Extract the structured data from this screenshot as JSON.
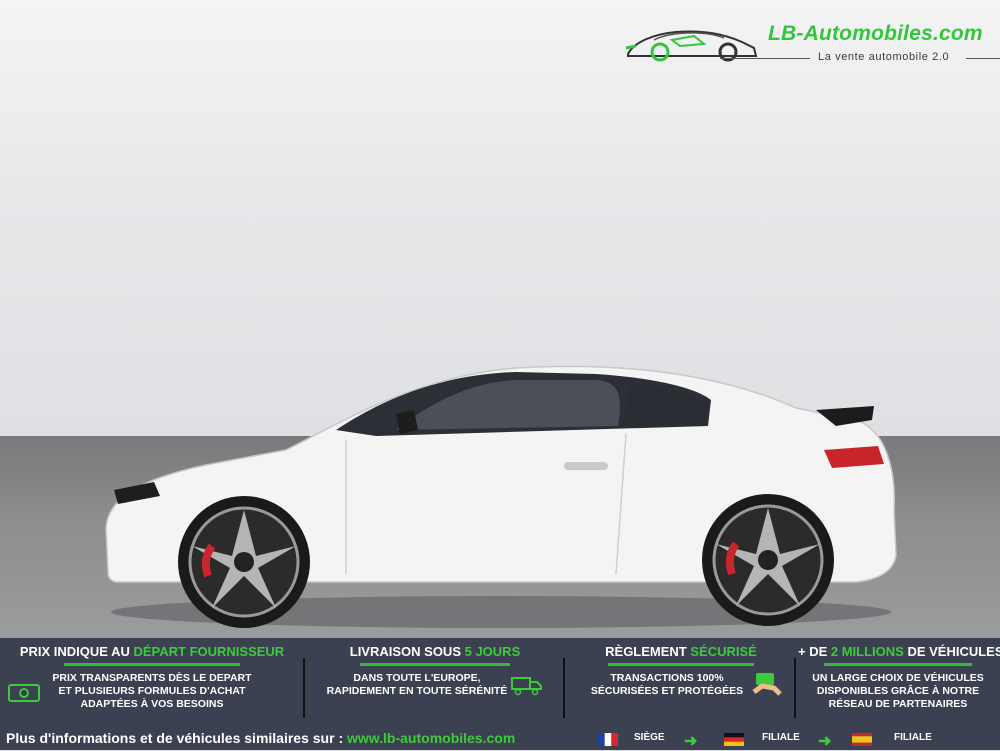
{
  "logo": {
    "brand": "LB-Automobiles.com",
    "tagline": "La vente automobile 2.0"
  },
  "features": [
    {
      "head_prefix": "PRIX INDIQUE AU ",
      "head_highlight": "DÉPART FOURNISSEUR",
      "head_suffix": "",
      "body_lines": [
        "PRIX TRANSPARENTS DÈS LE DEPART",
        "ET PLUSIEURS FORMULES D'ACHAT",
        "ADAPTÉES À VOS BESOINS"
      ],
      "icon": "money-icon"
    },
    {
      "head_prefix": "LIVRAISON SOUS ",
      "head_highlight": "5 JOURS",
      "head_suffix": "",
      "body_lines": [
        "DANS TOUTE L'EUROPE,",
        "RAPIDEMENT EN TOUTE SÉRÉNITÉ"
      ],
      "icon": "truck-icon"
    },
    {
      "head_prefix": "RÈGLEMENT ",
      "head_highlight": "SÉCURISÉ",
      "head_suffix": "",
      "body_lines": [
        "TRANSACTIONS 100%",
        "SÉCURISÉES ET PROTÉGÉES"
      ],
      "icon": "payment-icon"
    },
    {
      "head_prefix": "+ DE ",
      "head_highlight": "2 MILLIONS",
      "head_suffix": " DE VÉHICULES",
      "body_lines": [
        "UN LARGE CHOIX DE VÉHICULES",
        "DISPONIBLES GRÂCE À NOTRE",
        "RÉSEAU DE PARTENAIRES"
      ],
      "icon": ""
    }
  ],
  "footer": {
    "text": "Plus d'informations et de véhicules similaires sur : ",
    "url": "www.lb-automobiles.com"
  },
  "locations": [
    {
      "country": "france",
      "label": "SIÈGE"
    },
    {
      "country": "germany",
      "label": "FILIALE"
    },
    {
      "country": "spain",
      "label": "FILIALE"
    }
  ],
  "colors": {
    "accent_green": "#3ccc3a",
    "banner_bg": "#3b4150",
    "car_body": "#f7f7f7"
  }
}
